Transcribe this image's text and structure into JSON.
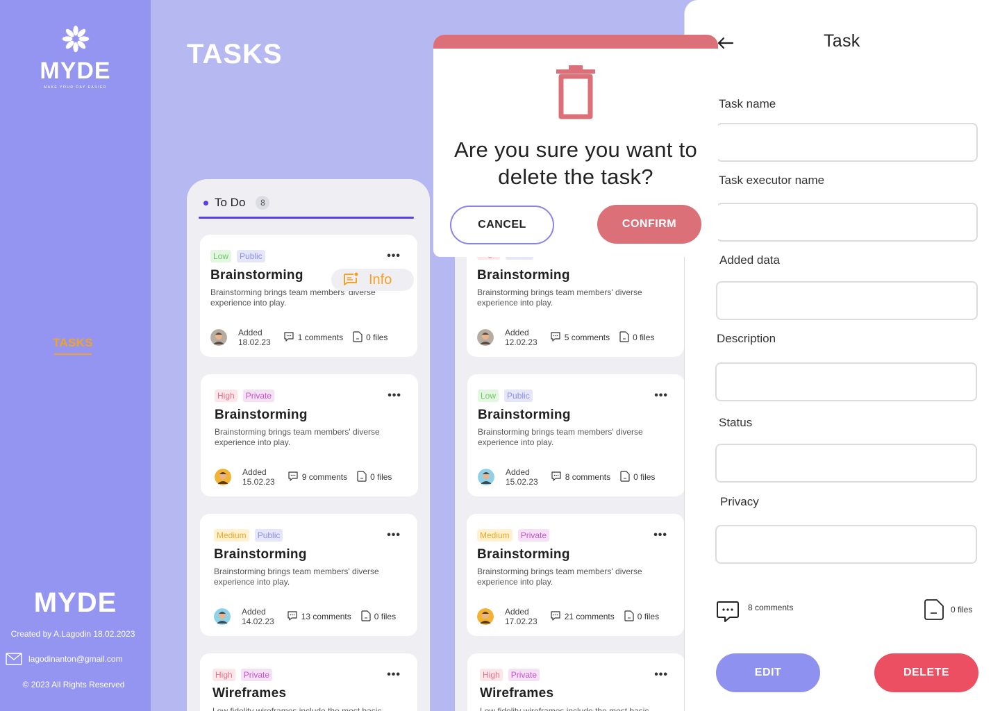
{
  "sidebar": {
    "brand": "MYDE",
    "tagline": "MAKE YOUR DAY EASIER",
    "nav_tasks": "TASKS",
    "brand_bottom": "MYDE",
    "created": "Created by A.Lagodin 18.02.2023",
    "email": "lagodinanton@gmail.com",
    "rights": "© 2023 All Rights Reserved"
  },
  "page": {
    "title": "TASKS"
  },
  "column": {
    "label": "To Do",
    "count": "8"
  },
  "info_label": "Info",
  "cards_left": [
    {
      "priority": "Low",
      "privacy": "Public",
      "title": "Brainstorming",
      "desc": "Brainstorming brings team members' diverse experience into play.",
      "added_label": "Added",
      "date": "18.02.23",
      "comments": "1 comments",
      "files": "0 files"
    },
    {
      "priority": "High",
      "privacy": "Private",
      "title": "Brainstorming",
      "desc": "Brainstorming brings team members' diverse experience into play.",
      "added_label": "Added",
      "date": "15.02.23",
      "comments": "9 comments",
      "files": "0 files"
    },
    {
      "priority": "Medium",
      "privacy": "Public",
      "title": "Brainstorming",
      "desc": "Brainstorming brings team members' diverse experience into play.",
      "added_label": "Added",
      "date": "14.02.23",
      "comments": "13 comments",
      "files": "0 files"
    },
    {
      "priority": "High",
      "privacy": "Private",
      "title": "Wireframes",
      "desc": "Low fidelity wireframes include the most basic",
      "added_label": "Added",
      "date": "",
      "comments": "",
      "files": ""
    }
  ],
  "cards_right": [
    {
      "priority": "High",
      "privacy": "Public",
      "title": "Brainstorming",
      "desc": "Brainstorming brings team members' diverse experience into play.",
      "added_label": "Added",
      "date": "12.02.23",
      "comments": "5 comments",
      "files": "0 files"
    },
    {
      "priority": "Low",
      "privacy": "Public",
      "title": "Brainstorming",
      "desc": "Brainstorming brings team members' diverse experience into play.",
      "added_label": "Added",
      "date": "15.02.23",
      "comments": "8 comments",
      "files": "0 files"
    },
    {
      "priority": "Medium",
      "privacy": "Private",
      "title": "Brainstorming",
      "desc": "Brainstorming brings team members' diverse experience into play.",
      "added_label": "Added",
      "date": "17.02.23",
      "comments": "21 comments",
      "files": "0 files"
    },
    {
      "priority": "High",
      "privacy": "Private",
      "title": "Wireframes",
      "desc": "Low fidelity wireframes include the most basic",
      "added_label": "Added",
      "date": "",
      "comments": "",
      "files": ""
    }
  ],
  "modal": {
    "question": "Are you sure you want to delete the task?",
    "cancel": "CANCEL",
    "confirm": "CONFIRM"
  },
  "panel": {
    "title": "Task",
    "labels": {
      "task_name": "Task name",
      "executor": "Task executor name",
      "added": "Added data",
      "description": "Description",
      "status": "Status",
      "privacy": "Privacy"
    },
    "values": {
      "task_name": "",
      "executor": "",
      "added": "",
      "description": "",
      "status": "",
      "privacy": ""
    },
    "comments": "8 comments",
    "files": "0 files",
    "edit": "EDIT",
    "delete": "DELETE"
  },
  "colors": {
    "accent": "#5a3fe6",
    "sidebar": "#9495f0",
    "orange": "#f4a226",
    "danger": "#ec4e62",
    "modal": "#db7079"
  }
}
